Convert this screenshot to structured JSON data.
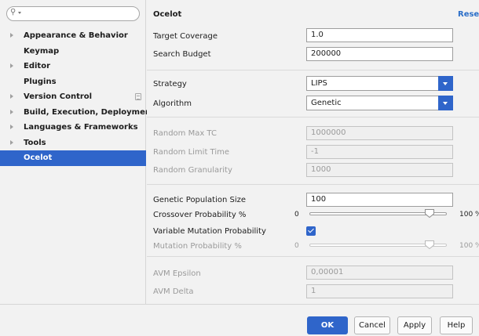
{
  "search": {
    "placeholder": "",
    "icon": "search-icon"
  },
  "sidebar": {
    "items": [
      {
        "label": "Appearance & Behavior",
        "expandable": true,
        "selected": false
      },
      {
        "label": "Keymap",
        "expandable": false,
        "selected": false
      },
      {
        "label": "Editor",
        "expandable": true,
        "selected": false
      },
      {
        "label": "Plugins",
        "expandable": false,
        "selected": false
      },
      {
        "label": "Version Control",
        "expandable": true,
        "selected": false
      },
      {
        "label": "Build, Execution, Deployment",
        "expandable": true,
        "selected": false
      },
      {
        "label": "Languages & Frameworks",
        "expandable": true,
        "selected": false
      },
      {
        "label": "Tools",
        "expandable": true,
        "selected": false
      },
      {
        "label": "Ocelot",
        "expandable": false,
        "selected": true
      }
    ]
  },
  "main": {
    "title": "Ocelot",
    "reset_label": "Reset",
    "target_coverage": {
      "label": "Target Coverage",
      "value": "1.0"
    },
    "search_budget": {
      "label": "Search Budget",
      "value": "200000"
    },
    "strategy": {
      "label": "Strategy",
      "value": "LIPS"
    },
    "algorithm": {
      "label": "Algorithm",
      "value": "Genetic"
    },
    "random_max_tc": {
      "label": "Random Max TC",
      "value": "1000000"
    },
    "random_limit_time": {
      "label": "Random Limit Time",
      "value": "-1"
    },
    "random_granularity": {
      "label": "Random Granularity",
      "value": "1000"
    },
    "genetic_population_size": {
      "label": "Genetic Population Size",
      "value": "100"
    },
    "crossover_probability": {
      "label": "Crossover Probability %",
      "min": "0",
      "max": "100 %",
      "level_percent": 90
    },
    "variable_mutation": {
      "label": "Variable Mutation Probability",
      "checked": true
    },
    "mutation_probability": {
      "label": "Mutation Probability %",
      "min": "0",
      "max": "100 %",
      "level_percent": 90
    },
    "avm_epsilon": {
      "label": "AVM Epsilon",
      "value": "0,00001"
    },
    "avm_delta": {
      "label": "AVM Delta",
      "value": "1"
    }
  },
  "footer": {
    "ok_label": "OK",
    "cancel_label": "Cancel",
    "apply_label": "Apply",
    "help_label": "Help"
  },
  "colors": {
    "accent": "#2f65ca",
    "link": "#2b6ec8",
    "selection": "#2f65ca"
  }
}
